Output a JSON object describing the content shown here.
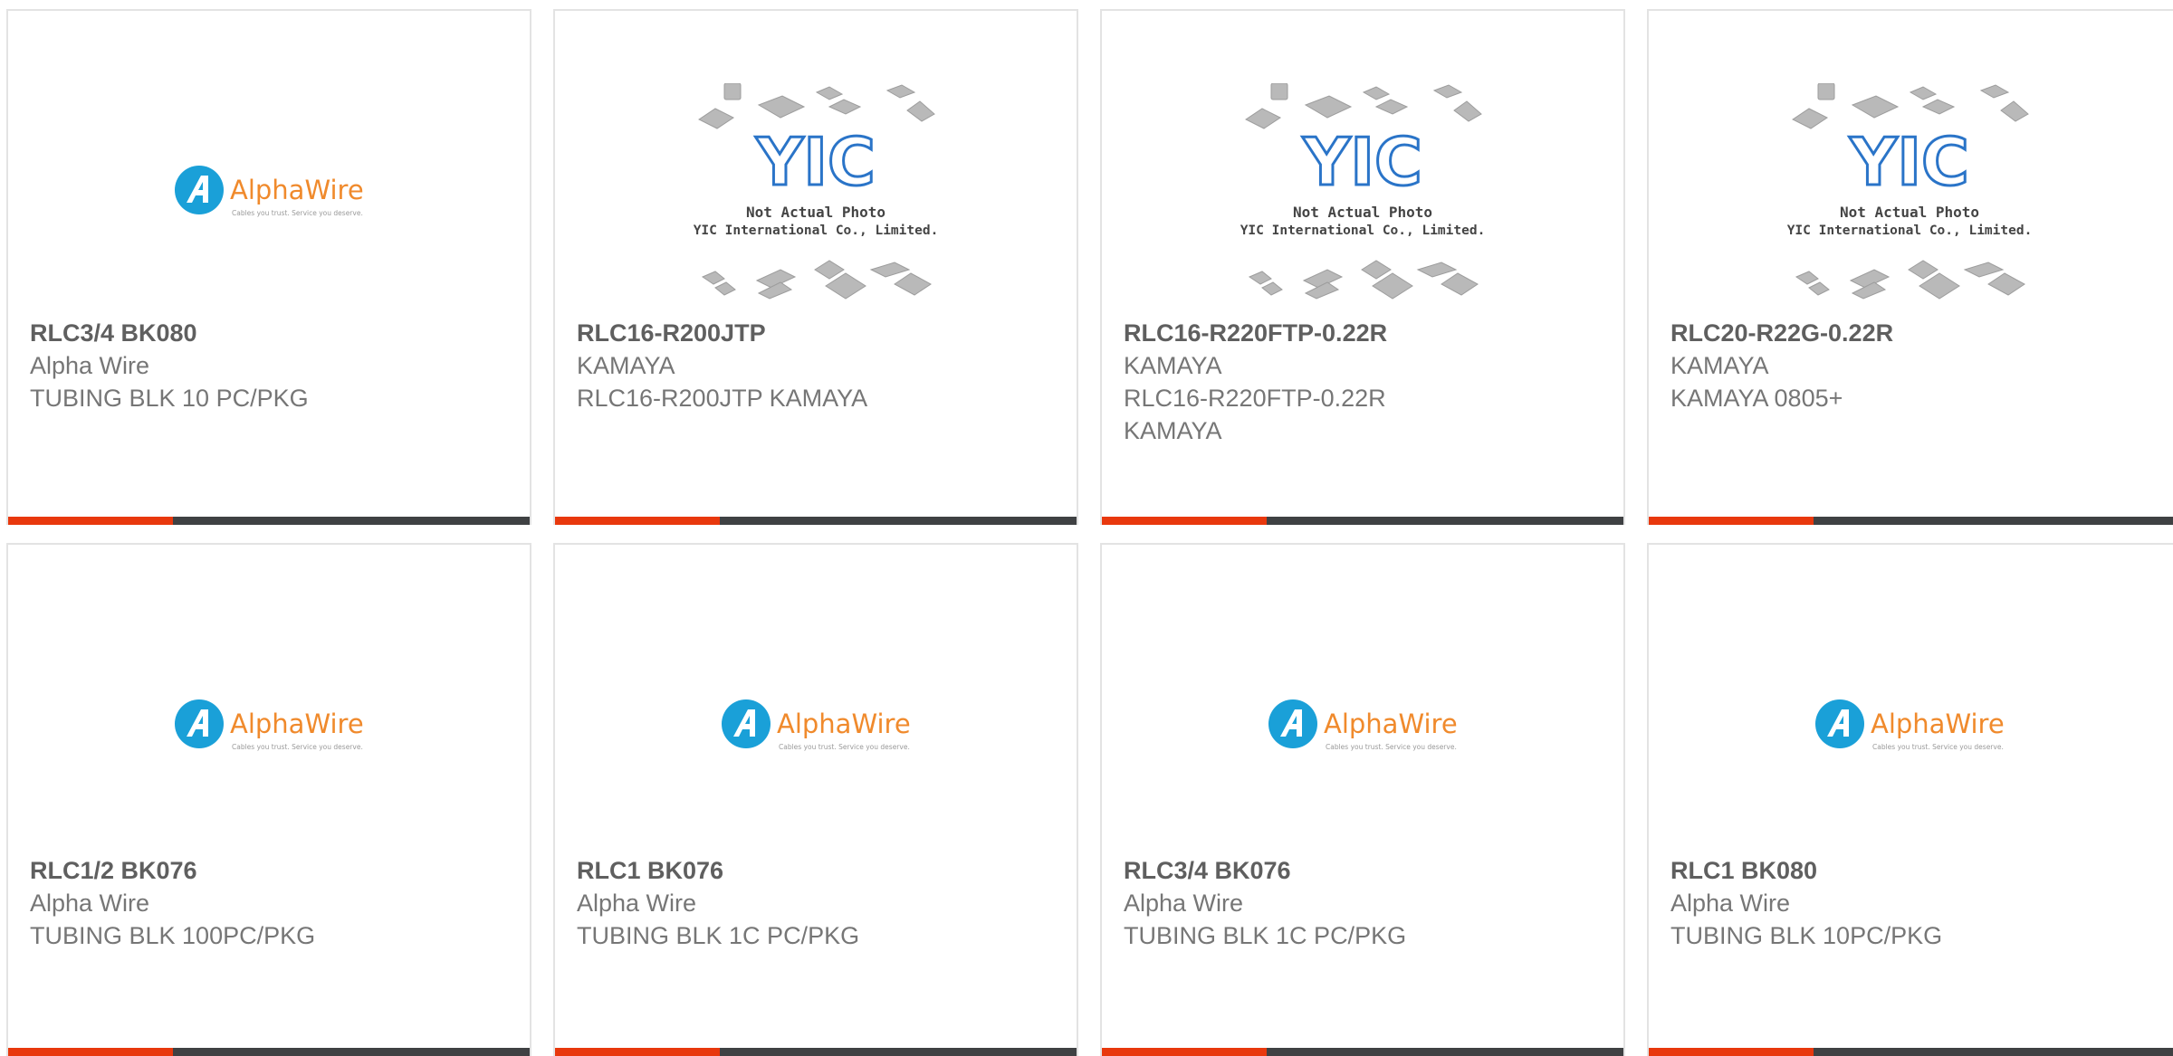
{
  "colors": {
    "accent": "#e8380d",
    "bar": "#3f4143",
    "title": "#5f5f5f",
    "text": "#767676",
    "alpha_blue": "#1aa0d8",
    "alpha_orange": "#f08a2c",
    "yic_blue": "#2a74c8"
  },
  "products": [
    {
      "part": "RLC3/4 BK080",
      "mfr": "Alpha Wire",
      "desc": "TUBING BLK 10 PC/PKG",
      "image": "alphawire-logo"
    },
    {
      "part": "RLC16-R200JTP",
      "mfr": "KAMAYA",
      "desc": "RLC16-R200JTP KAMAYA",
      "image": "yic-not-actual-photo"
    },
    {
      "part": "RLC16-R220FTP-0.22R",
      "mfr": "KAMAYA",
      "desc": "RLC16-R220FTP-0.22R KAMAYA",
      "image": "yic-not-actual-photo"
    },
    {
      "part": "RLC20-R22G-0.22R",
      "mfr": "KAMAYA",
      "desc": "KAMAYA 0805+",
      "image": "yic-not-actual-photo"
    },
    {
      "part": "RLC1/2 BK076",
      "mfr": "Alpha Wire",
      "desc": "TUBING BLK 100PC/PKG",
      "image": "alphawire-logo"
    },
    {
      "part": "RLC1 BK076",
      "mfr": "Alpha Wire",
      "desc": "TUBING BLK 1C PC/PKG",
      "image": "alphawire-logo"
    },
    {
      "part": "RLC3/4 BK076",
      "mfr": "Alpha Wire",
      "desc": "TUBING BLK 1C PC/PKG",
      "image": "alphawire-logo"
    },
    {
      "part": "RLC1 BK080",
      "mfr": "Alpha Wire",
      "desc": "TUBING BLK 10PC/PKG",
      "image": "alphawire-logo"
    }
  ],
  "alphawire_logo": {
    "name": "AlphaWire",
    "tagline": "Cables you trust. Service you deserve."
  },
  "yic_placeholder": {
    "logo": "YIC",
    "line1": "Not Actual Photo",
    "line2": "YIC International Co., Limited."
  }
}
